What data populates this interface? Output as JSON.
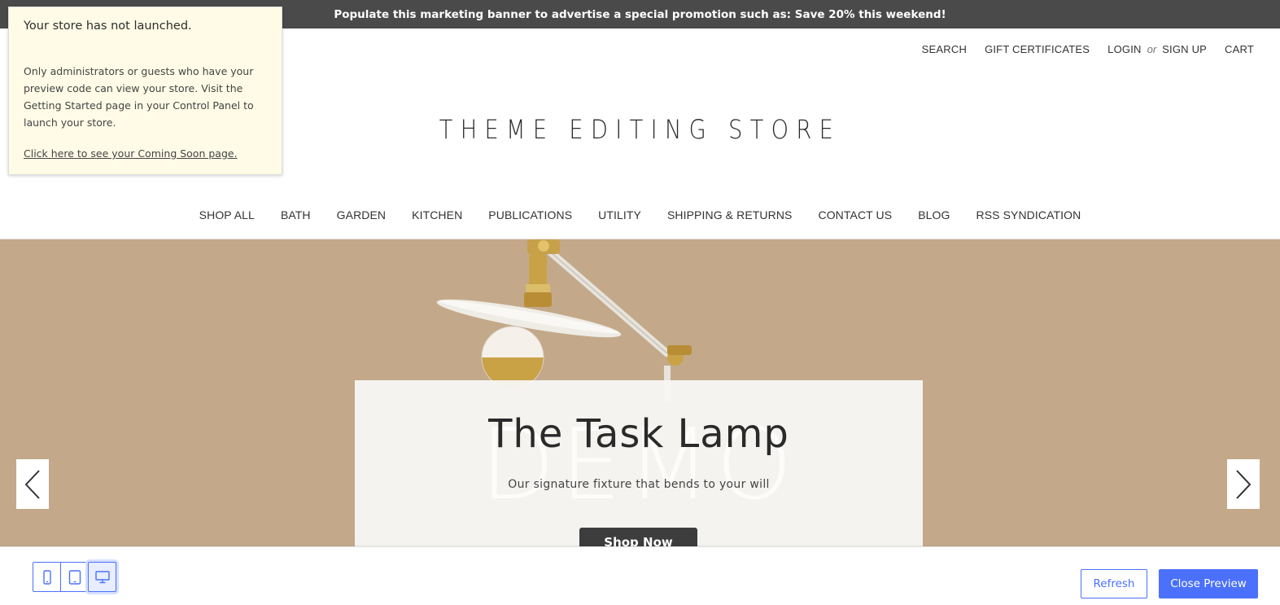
{
  "promo_banner": {
    "text": "Populate this marketing banner to advertise a special promotion such as: Save 20% this weekend!"
  },
  "utility_nav": {
    "search": "SEARCH",
    "gift_certificates": "GIFT CERTIFICATES",
    "login": "LOGIN",
    "or": "or",
    "sign_up": "SIGN UP",
    "cart": "CART"
  },
  "store": {
    "title": "THEME EDITING STORE"
  },
  "main_nav": {
    "items": [
      {
        "label": "SHOP ALL"
      },
      {
        "label": "BATH"
      },
      {
        "label": "GARDEN"
      },
      {
        "label": "KITCHEN"
      },
      {
        "label": "PUBLICATIONS"
      },
      {
        "label": "UTILITY"
      },
      {
        "label": "SHIPPING & RETURNS"
      },
      {
        "label": "CONTACT US"
      },
      {
        "label": "BLOG"
      },
      {
        "label": "RSS SYNDICATION"
      }
    ]
  },
  "hero": {
    "title": "The Task Lamp",
    "subtitle": "Our signature fixture that bends to your will",
    "button_label": "Shop Now",
    "watermark": "DEMO",
    "background_color": "#c3a98a"
  },
  "notice": {
    "title": "Your store has not launched.",
    "body": "Only administrators or guests who have your preview code can view your store. Visit the Getting Started page in your Control Panel to launch your store.",
    "link": "Click here to see your Coming Soon page."
  },
  "preview_bar": {
    "devices": [
      {
        "icon": "mobile-icon"
      },
      {
        "icon": "tablet-icon"
      },
      {
        "icon": "desktop-icon",
        "active": true
      }
    ],
    "refresh_label": "Refresh",
    "close_label": "Close Preview",
    "accent_color": "#4b71fc"
  }
}
